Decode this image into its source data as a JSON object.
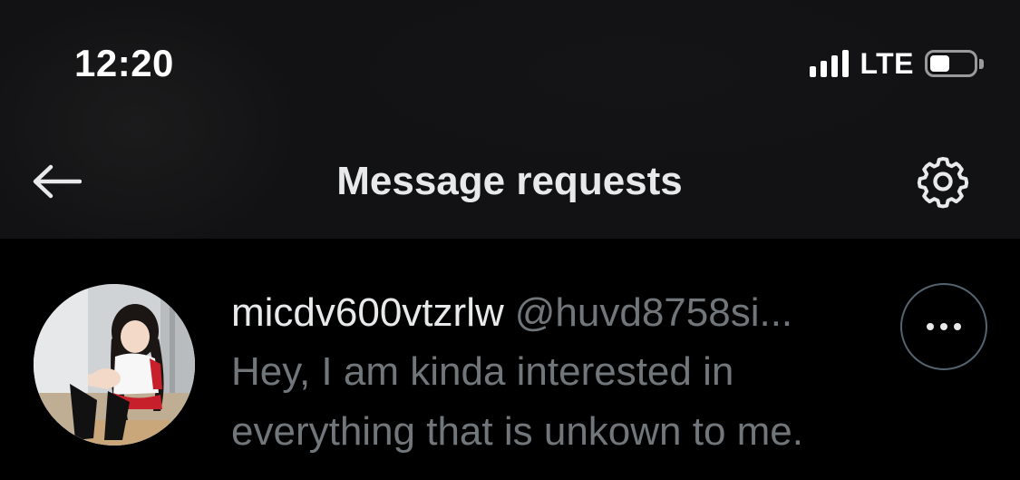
{
  "status_bar": {
    "time": "12:20",
    "network": "LTE",
    "signal_bars": 4,
    "battery_level": 0.45
  },
  "nav": {
    "title": "Message requests",
    "back_icon": "back-arrow-icon",
    "settings_icon": "gear-icon"
  },
  "requests": [
    {
      "display_name": "micdv600vtzrlw",
      "handle": "@huvd8758si...",
      "message": "Hey, I am kinda interested in everything that is unkown to me.",
      "avatar_icon": "avatar-photo",
      "more_icon": "more-horizontal-icon"
    }
  ],
  "colors": {
    "background": "#000000",
    "header_background": "#121214",
    "primary_text": "#e7e9ea",
    "secondary_text": "#71767b",
    "border": "#536471"
  }
}
